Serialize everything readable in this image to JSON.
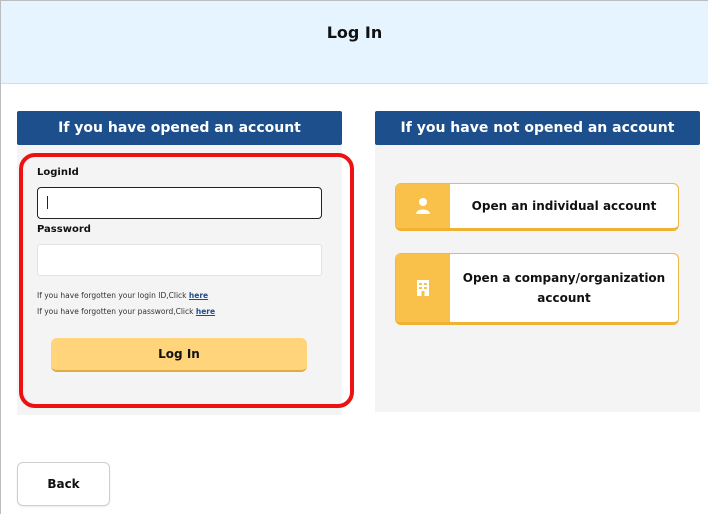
{
  "header": {
    "title": "Log In"
  },
  "left": {
    "heading": "If you have opened an account",
    "login_id_label": "LoginId",
    "login_id_value": "",
    "password_label": "Password",
    "password_value": "",
    "forgot_id_text": "If you have forgotten your login ID,Click ",
    "forgot_password_text": "If you have forgotten your password,Click ",
    "here_link": "here",
    "login_button": "Log In"
  },
  "right": {
    "heading": "If you have not opened an account",
    "individual_button": "Open an individual account",
    "company_button": "Open a company/organization account",
    "individual_icon": "person-icon",
    "company_icon": "building-icon"
  },
  "footer": {
    "back_button": "Back"
  },
  "colors": {
    "header_bg": "#e6f4ff",
    "heading_bg": "#1c4f8b",
    "accent_yellow": "#f9c14a",
    "login_button_bg": "#ffd47a",
    "highlight_red": "#ee1111"
  }
}
